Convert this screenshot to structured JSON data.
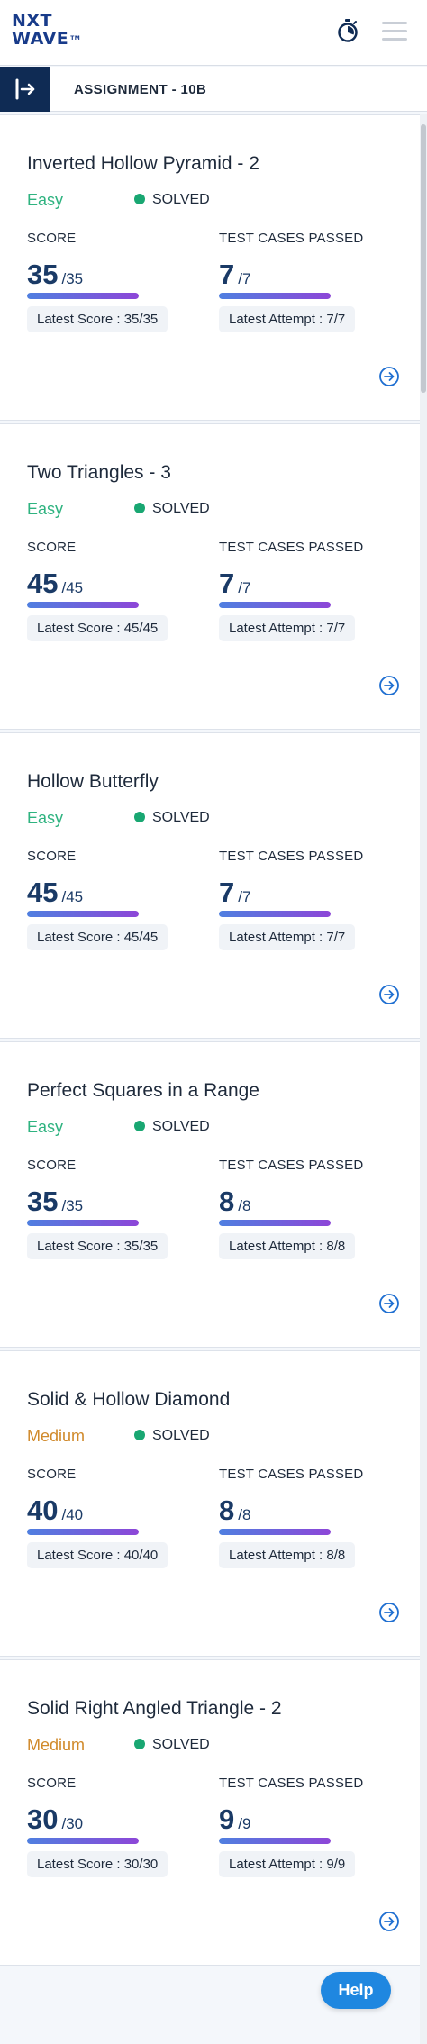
{
  "logo": {
    "line1": "NXT",
    "line2": "WAVE",
    "tm": "TM"
  },
  "header": {
    "stopwatch_icon": "stopwatch-icon",
    "menu_icon": "hamburger-icon"
  },
  "assignment": {
    "title": "ASSIGNMENT - 10B",
    "toggle_icon": "sidebar-expand-icon"
  },
  "labels": {
    "score": "SCORE",
    "tests": "TEST CASES PASSED",
    "solved": "SOLVED"
  },
  "colors": {
    "easy": "#2fb380",
    "medium": "#d0892a",
    "solved": "#19a772",
    "navy": "#0f2b54",
    "help": "#1f87e0"
  },
  "problems": [
    {
      "title": "Inverted Hollow Pyramid - 2",
      "difficulty": "Easy",
      "status": "SOLVED",
      "score": "35",
      "score_total": "/35",
      "score_progress": 1,
      "tests": "7",
      "tests_total": "/7",
      "tests_progress": 1,
      "latest_score": "Latest Score : 35/35",
      "latest_attempt": "Latest Attempt : 7/7"
    },
    {
      "title": "Two Triangles - 3",
      "difficulty": "Easy",
      "status": "SOLVED",
      "score": "45",
      "score_total": "/45",
      "score_progress": 1,
      "tests": "7",
      "tests_total": "/7",
      "tests_progress": 1,
      "latest_score": "Latest Score : 45/45",
      "latest_attempt": "Latest Attempt : 7/7"
    },
    {
      "title": "Hollow Butterfly",
      "difficulty": "Easy",
      "status": "SOLVED",
      "score": "45",
      "score_total": "/45",
      "score_progress": 1,
      "tests": "7",
      "tests_total": "/7",
      "tests_progress": 1,
      "latest_score": "Latest Score : 45/45",
      "latest_attempt": "Latest Attempt : 7/7"
    },
    {
      "title": "Perfect Squares in a Range",
      "difficulty": "Easy",
      "status": "SOLVED",
      "score": "35",
      "score_total": "/35",
      "score_progress": 1,
      "tests": "8",
      "tests_total": "/8",
      "tests_progress": 1,
      "latest_score": "Latest Score : 35/35",
      "latest_attempt": "Latest Attempt : 8/8"
    },
    {
      "title": "Solid & Hollow Diamond",
      "difficulty": "Medium",
      "status": "SOLVED",
      "score": "40",
      "score_total": "/40",
      "score_progress": 1,
      "tests": "8",
      "tests_total": "/8",
      "tests_progress": 1,
      "latest_score": "Latest Score : 40/40",
      "latest_attempt": "Latest Attempt : 8/8"
    },
    {
      "title": "Solid Right Angled Triangle - 2",
      "difficulty": "Medium",
      "status": "SOLVED",
      "score": "30",
      "score_total": "/30",
      "score_progress": 1,
      "tests": "9",
      "tests_total": "/9",
      "tests_progress": 1,
      "latest_score": "Latest Score : 30/30",
      "latest_attempt": "Latest Attempt : 9/9"
    }
  ],
  "help": {
    "label": "Help"
  }
}
